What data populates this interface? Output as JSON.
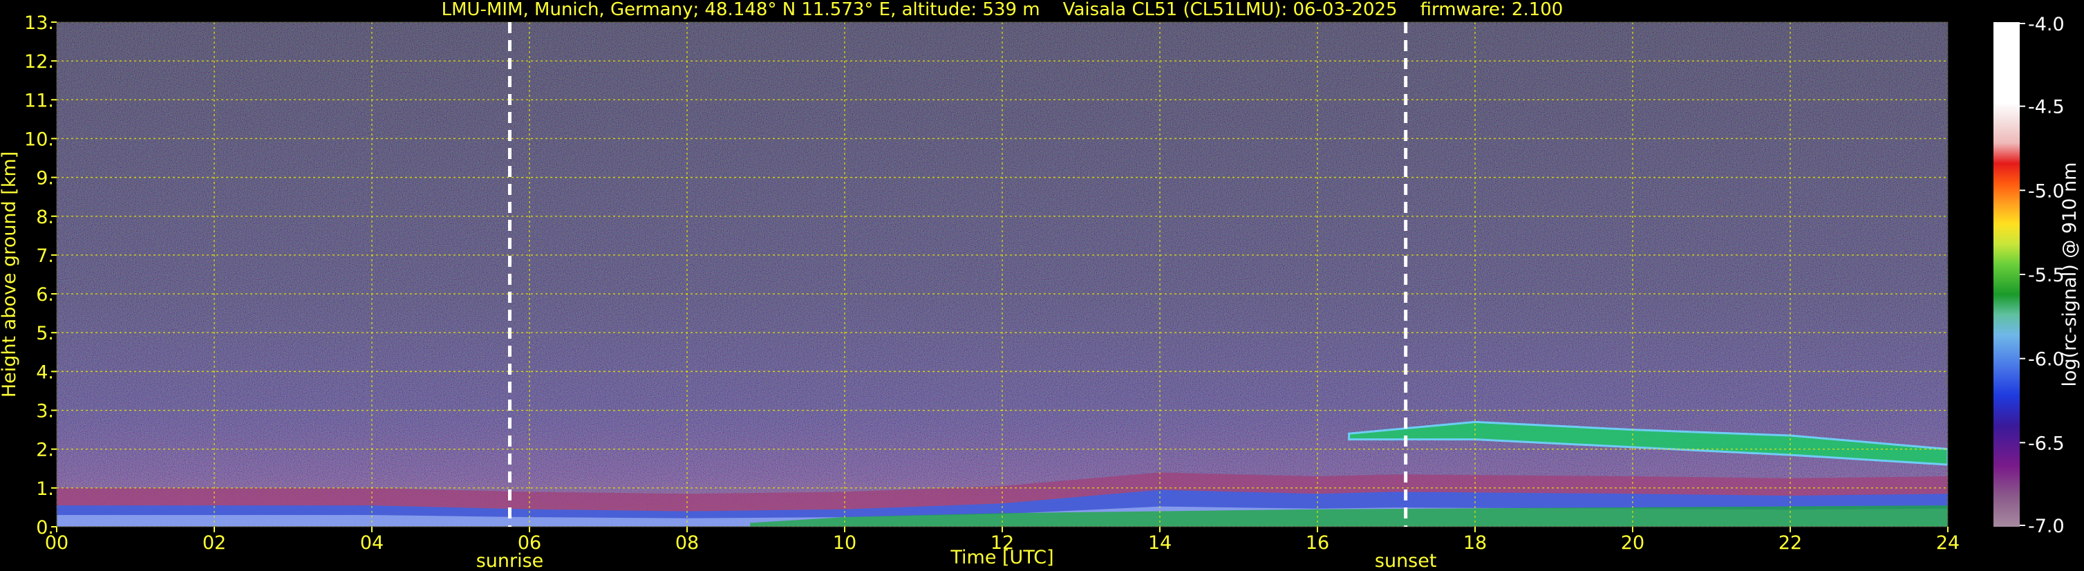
{
  "chart_data": {
    "type": "heatmap",
    "title": "LMU-MIM, Munich, Germany; 48.148° N 11.573° E, altitude: 539 m    Vaisala CL51 (CL51LMU): 06-03-2025    firmware: 2.100",
    "xlabel": "Time [UTC]",
    "ylabel": "Height above ground [km]",
    "xlim": [
      0,
      24
    ],
    "ylim": [
      0,
      13
    ],
    "x_ticks": [
      0,
      2,
      4,
      6,
      8,
      10,
      12,
      14,
      16,
      18,
      20,
      22,
      24
    ],
    "x_tick_labels": [
      "00",
      "02",
      "04",
      "06",
      "08",
      "10",
      "12",
      "14",
      "16",
      "18",
      "20",
      "22",
      "24"
    ],
    "y_ticks": [
      0,
      1,
      2,
      3,
      4,
      5,
      6,
      7,
      8,
      9,
      10,
      11,
      12,
      13
    ],
    "y_tick_labels": [
      "0.",
      "1.",
      "2.",
      "3.",
      "4.",
      "5.",
      "6.",
      "7.",
      "8.",
      "9.",
      "10.",
      "11.",
      "12.",
      "13."
    ],
    "grid": true,
    "annotations": [
      {
        "label": "sunrise",
        "time": 5.75
      },
      {
        "label": "sunset",
        "time": 17.12
      }
    ],
    "colorbar": {
      "label": "log(rc-signal) @ 910 nm",
      "range": [
        -7.0,
        -4.0
      ],
      "ticks": [
        -4.0,
        -4.5,
        -5.0,
        -5.5,
        -6.0,
        -6.5,
        -7.0
      ],
      "tick_labels": [
        "-4.0",
        "-4.5",
        "-5.0",
        "-5.5",
        "-6.0",
        "-6.5",
        "-7.0"
      ]
    },
    "layers": {
      "boundary_layer_top_km": [
        [
          0,
          0.55
        ],
        [
          4,
          0.55
        ],
        [
          6,
          0.45
        ],
        [
          8,
          0.4
        ],
        [
          10,
          0.45
        ],
        [
          12,
          0.6
        ],
        [
          14,
          0.95
        ],
        [
          16,
          0.85
        ],
        [
          17,
          0.9
        ],
        [
          20,
          0.85
        ],
        [
          22,
          0.8
        ],
        [
          24,
          0.85
        ]
      ],
      "elevated_layer": [
        {
          "time": 16.4,
          "top_km": 2.4,
          "bottom_km": 2.25
        },
        {
          "time": 18.0,
          "top_km": 2.7,
          "bottom_km": 2.25
        },
        {
          "time": 20.0,
          "top_km": 2.5,
          "bottom_km": 2.05
        },
        {
          "time": 22.0,
          "top_km": 2.35,
          "bottom_km": 1.85
        },
        {
          "time": 24.0,
          "top_km": 2.0,
          "bottom_km": 1.6
        }
      ],
      "green_aerosol_band": [
        {
          "time": 8.8,
          "top_km": 0.1
        },
        {
          "time": 10.0,
          "top_km": 0.25
        },
        {
          "time": 12.0,
          "top_km": 0.35
        },
        {
          "time": 16.0,
          "top_km": 0.45
        },
        {
          "time": 24.0,
          "top_km": 0.55
        }
      ]
    }
  }
}
